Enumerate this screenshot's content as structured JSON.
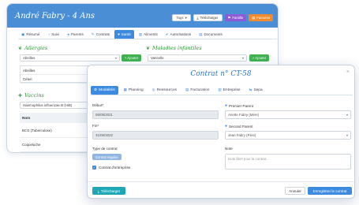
{
  "background_window": {
    "title": "André Fabry - 4 Ans",
    "header_buttons": {
      "tags": "Tags",
      "download": "Télécharger",
      "family": "Famille",
      "invoices": "Factures"
    },
    "tabs": [
      {
        "label": "Résumé",
        "icon": "summary-icon"
      },
      {
        "label": "Suivi",
        "icon": "followup-icon"
      },
      {
        "label": "Parents",
        "icon": "parents-icon"
      },
      {
        "label": "Contrats",
        "icon": "contracts-icon"
      },
      {
        "label": "Santé",
        "icon": "heart-icon",
        "active": true
      },
      {
        "label": "Aliments",
        "icon": "food-icon"
      },
      {
        "label": "Autorisations",
        "icon": "authorization-icon"
      },
      {
        "label": "Documents",
        "icon": "documents-icon"
      }
    ],
    "allergies": {
      "title": "Allergies",
      "select_value": "Abeilles",
      "add_label": "+ Ajouter",
      "items": [
        "Abeilles",
        "Céleri"
      ]
    },
    "diseases": {
      "title": "Maladies infantiles",
      "select_value": "Varicelle",
      "add_label": "+ Ajouter"
    },
    "vaccines": {
      "title": "Vaccins",
      "select_value": "Haemophilus influenzae B (HiB)",
      "table_header": "Nom",
      "rows": [
        "BCG (Tuberculose)",
        "Coqueluche"
      ]
    }
  },
  "modal": {
    "title": "Contrat n° CT-58",
    "close": "×",
    "tabs": [
      {
        "label": "Modalités",
        "icon": "settings-icon",
        "active": true
      },
      {
        "label": "Planning",
        "icon": "calendar-icon"
      },
      {
        "label": "Ressources",
        "icon": "resources-icon"
      },
      {
        "label": "Facturation",
        "icon": "billing-icon"
      },
      {
        "label": "Entreprise",
        "icon": "company-icon"
      },
      {
        "label": "Sepa",
        "icon": "sepa-icon"
      }
    ],
    "start_label": "Début*",
    "start_value": "06/09/2021",
    "end_label": "Fin*",
    "end_value": "31/08/2022",
    "contract_type_label": "Type de contrat",
    "contract_type_value": "Contrat régulier",
    "company_contract_label": "Contrat d'entreprise",
    "first_parent_label": "Premier Parent",
    "first_parent_value": "Ariette Fabry (Mère)",
    "second_parent_label": "Second Parent",
    "second_parent_value": "Jean Fabry (Père)",
    "note_label": "Note",
    "note_placeholder": "Note libre pour le contrat...",
    "download_label": "Télécharger",
    "cancel_label": "Annuler",
    "save_label": "Enregistrer le contrat"
  },
  "colors": {
    "primary": "#3d8be0",
    "header": "#4a8fd6",
    "section_green": "#2f9a3a",
    "family": "#8f5ad6",
    "invoices": "#f08a2c",
    "teal": "#1fa7b8"
  }
}
